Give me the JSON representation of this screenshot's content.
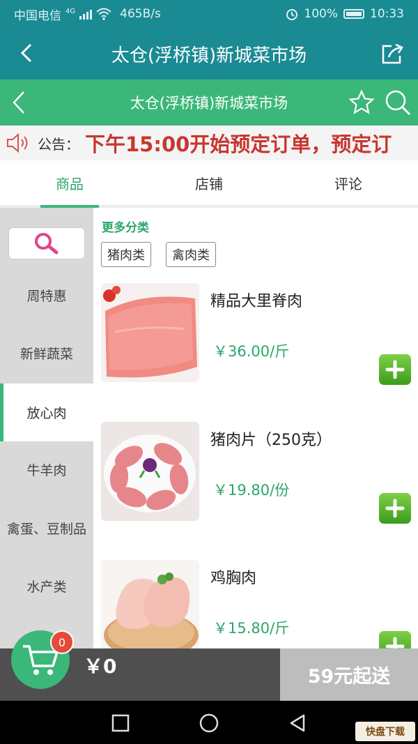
{
  "status_bar": {
    "carrier": "中国电信",
    "network": "4G",
    "speed": "465B/s",
    "battery": "100%",
    "time": "10:33"
  },
  "app_title": "太仓(浮桥镇)新城菜市场",
  "store_title": "太仓(浮桥镇)新城菜市场",
  "notice": {
    "label": "公告：",
    "text": "下午15:00开始预定订单，预定订"
  },
  "tabs": [
    {
      "label": "商品",
      "active": true
    },
    {
      "label": "店铺",
      "active": false
    },
    {
      "label": "评论",
      "active": false
    }
  ],
  "sidebar": {
    "categories": [
      {
        "label": "周特惠",
        "active": false
      },
      {
        "label": "新鲜蔬菜",
        "active": false
      },
      {
        "label": "放心肉",
        "active": true
      },
      {
        "label": "牛羊肉",
        "active": false
      },
      {
        "label": "禽蛋、豆制品",
        "active": false
      },
      {
        "label": "水产类",
        "active": false
      }
    ]
  },
  "main": {
    "more_categories": "更多分类",
    "chips": [
      "猪肉类",
      "禽肉类"
    ],
    "products": [
      {
        "name": "精品大里脊肉",
        "price": "￥36.00/斤",
        "image": "pork-tenderloin"
      },
      {
        "name": "猪肉片（250克）",
        "price": "￥19.80/份",
        "image": "pork-slices"
      },
      {
        "name": "鸡胸肉",
        "price": "￥15.80/斤",
        "image": "chicken-breast"
      }
    ]
  },
  "cart": {
    "count": "0",
    "amount": "￥0",
    "checkout": "59元起送"
  },
  "watermark": "快盘下载",
  "colors": {
    "status_bg": "#1a8a93",
    "green": "#3bb77a",
    "price_green": "#2ba66a",
    "notice_red": "#c8362e",
    "badge_red": "#e64a3b"
  }
}
